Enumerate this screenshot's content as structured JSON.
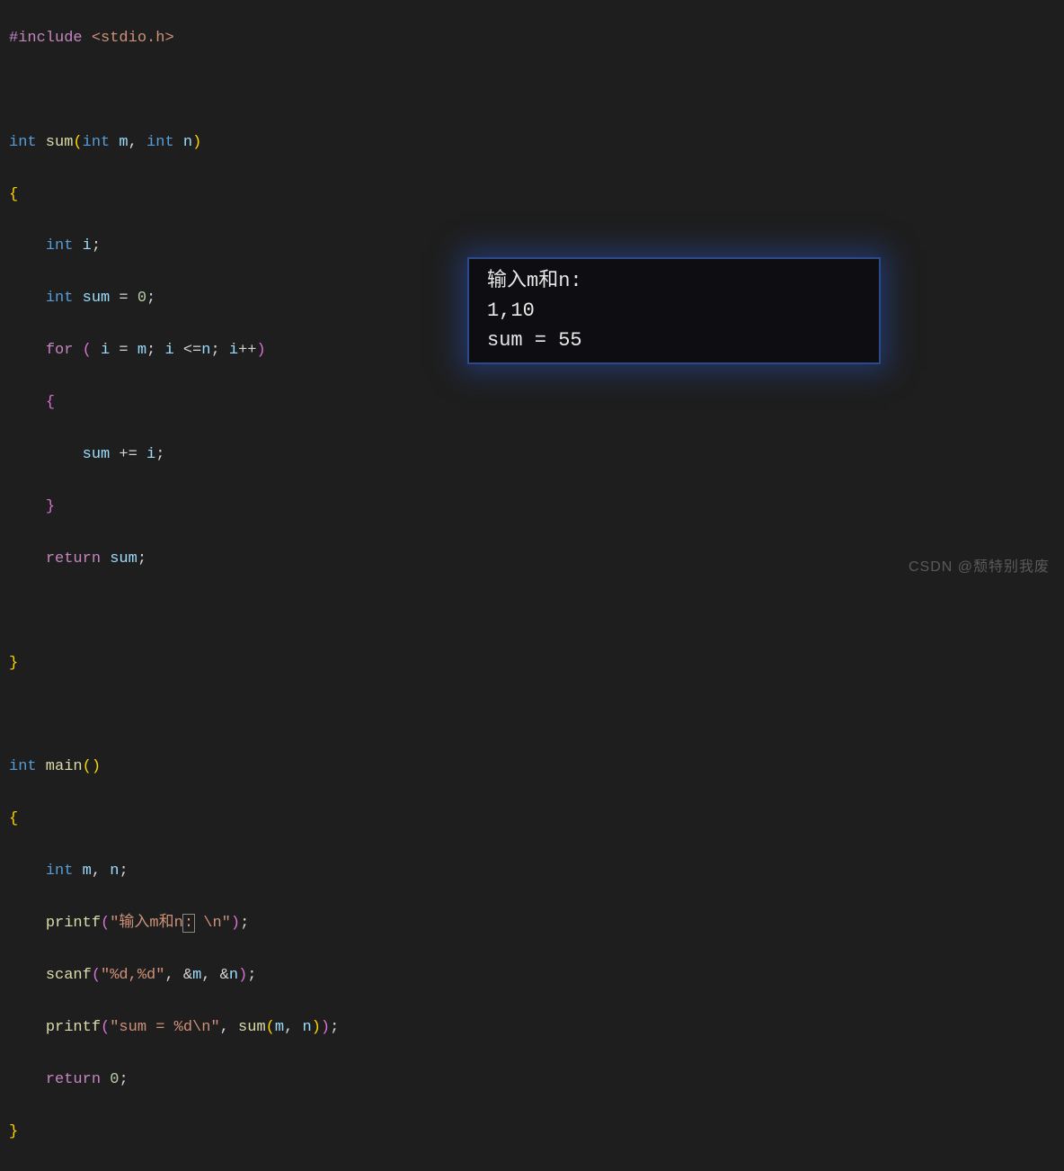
{
  "code": {
    "l1_pre": "#include",
    "l1_inc": " <stdio.h>",
    "l3_type1": "int",
    "l3_func": " sum",
    "l3_type2": "int",
    "l3_param1": " m",
    "l3_comma": ",",
    "l3_type3": " int",
    "l3_param2": " n",
    "l5_type": "int",
    "l5_var": " i",
    "l5_semi": ";",
    "l6_type": "int",
    "l6_var": " sum",
    "l6_eq": " = ",
    "l6_num": "0",
    "l6_semi": ";",
    "l7_for": "for",
    "l7_sp": " ",
    "l7_var1": " i",
    "l7_eq1": " = ",
    "l7_var2": "m",
    "l7_semi1": ";",
    "l7_var3": " i",
    "l7_op": " <=",
    "l7_var4": "n",
    "l7_semi2": ";",
    "l7_var5": " i",
    "l7_inc": "++",
    "l9_var": "sum",
    "l9_op": " += ",
    "l9_var2": "i",
    "l9_semi": ";",
    "l11_ret": "return",
    "l11_var": " sum",
    "l11_semi": ";",
    "l15_type": "int",
    "l15_func": " main",
    "l17_type": "int",
    "l17_var1": " m",
    "l17_comma": ",",
    "l17_var2": " n",
    "l17_semi": ";",
    "l18_func": "printf",
    "l18_str1": "\"输入m和n",
    "l18_str2": ":",
    "l18_str3": " \\n\"",
    "l18_semi": ";",
    "l19_func": "scanf",
    "l19_str": "\"%d,%d\"",
    "l19_comma1": ",",
    "l19_amp1": " &",
    "l19_var1": "m",
    "l19_comma2": ",",
    "l19_amp2": " &",
    "l19_var2": "n",
    "l19_semi": ";",
    "l20_func": "printf",
    "l20_str": "\"sum = %d\\n\"",
    "l20_comma": ",",
    "l20_func2": " sum",
    "l20_var1": "m",
    "l20_comma2": ",",
    "l20_var2": " n",
    "l20_semi": ";",
    "l21_ret": "return",
    "l21_num": " 0",
    "l21_semi": ";"
  },
  "output": {
    "line1": "输入m和n:",
    "line2": "1,10",
    "line3": "sum = 55"
  },
  "watermark": "CSDN @颓特别我废"
}
